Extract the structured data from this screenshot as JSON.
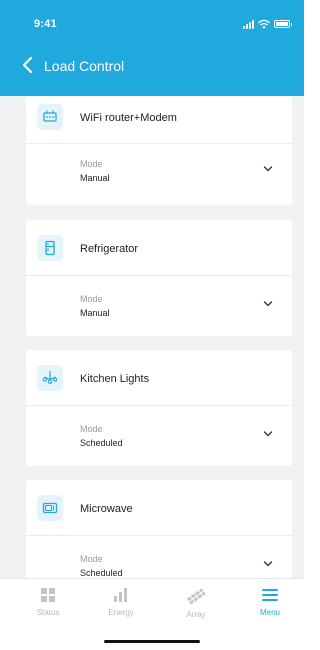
{
  "status_bar": {
    "time": "9:41"
  },
  "nav": {
    "title": "Load Control"
  },
  "devices": [
    {
      "name": "WiFi router+Modem",
      "icon": "router-icon",
      "mode_label": "Mode",
      "mode_value": "Manual"
    },
    {
      "name": "Refrigerator",
      "icon": "refrigerator-icon",
      "mode_label": "Mode",
      "mode_value": "Manual"
    },
    {
      "name": "Kitchen Lights",
      "icon": "chandelier-icon",
      "mode_label": "Mode",
      "mode_value": "Scheduled"
    },
    {
      "name": "Microwave",
      "icon": "microwave-icon",
      "mode_label": "Mode",
      "mode_value": "Scheduled"
    }
  ],
  "tabs": [
    {
      "label": "Status",
      "icon": "grid-icon",
      "active": false
    },
    {
      "label": "Energy",
      "icon": "bar-chart-icon",
      "active": false
    },
    {
      "label": "Array",
      "icon": "solar-panel-icon",
      "active": false
    },
    {
      "label": "Menu",
      "icon": "menu-icon",
      "active": true
    }
  ],
  "colors": {
    "accent": "#1fa9dd",
    "background": "#f1f2f4",
    "inactive_tab": "#b7b7b7"
  }
}
